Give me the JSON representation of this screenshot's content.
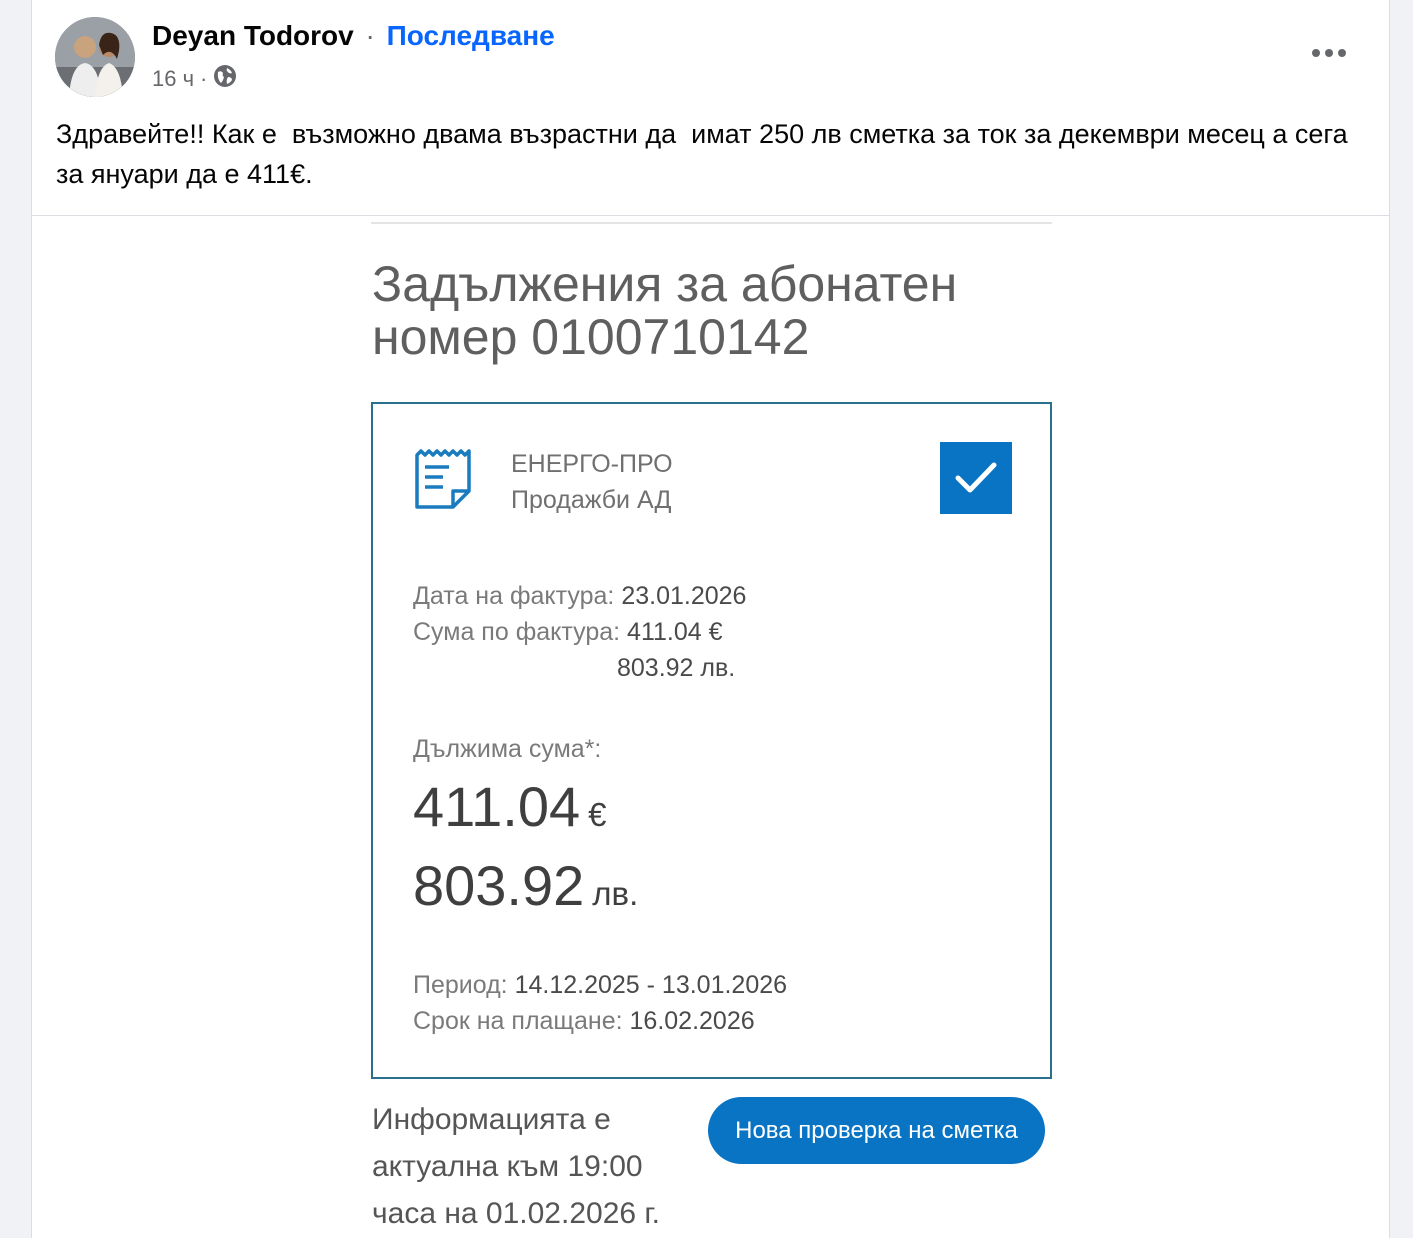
{
  "post": {
    "author": "Deyan Todorov",
    "separator": "·",
    "follow_label": "Последване",
    "time": "16 ч",
    "meta_separator": "·",
    "privacy_icon": "globe-icon",
    "more_icon": "more-horizontal-icon",
    "text": "Здравейте!! Как е  възможно двама възрастни да  имат 250 лв сметка за ток за декември месец а сега за януари да е 411€."
  },
  "bill": {
    "title": "Задължения за абонатен номер 0100710142",
    "company_line1": "ЕНЕРГО-ПРО",
    "company_line2": "Продажби АД",
    "invoice_date_label": "Дата на фактура: ",
    "invoice_date": "23.01.2026",
    "invoice_amount_label": "Сума по фактура: ",
    "invoice_amount_eur": "411.04 €",
    "invoice_amount_bgn": "803.92 лв.",
    "due_label": "Дължима сума*:",
    "due_eur_value": "411.04",
    "due_eur_currency": "€",
    "due_bgn_value": "803.92",
    "due_bgn_currency": "лв.",
    "period_label": "Период: ",
    "period": "14.12.2025 - 13.01.2026",
    "payment_deadline_label": "Срок на плащане: ",
    "payment_deadline": "16.02.2026",
    "info_text": "Информацията е актуална към 19:00 часа на 01.02.2026 г.",
    "new_check_button": "Нова проверка на сметка"
  },
  "colors": {
    "facebook_blue": "#0866ff",
    "bill_accent": "#0a74c4",
    "card_border": "#2a6f8c"
  }
}
